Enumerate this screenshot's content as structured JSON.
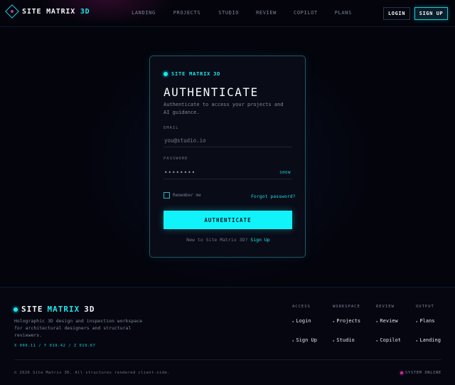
{
  "header": {
    "logo_main": "SITE MATRIX",
    "logo_accent": "3D",
    "nav": [
      "LANDING",
      "PROJECTS",
      "STUDIO",
      "REVIEW",
      "COPILOT",
      "PLANS"
    ],
    "login_label": "LOGIN",
    "signup_label": "SIGN UP"
  },
  "card": {
    "brand_main": "SITE MATRIX",
    "brand_accent": "3D",
    "title": "AUTHENTICATE",
    "subtitle": "Authenticate to access your projects and AI guidance.",
    "email_label": "EMAIL",
    "email_placeholder": "you@studio.io",
    "password_label": "PASSWORD",
    "password_value": "••••••••",
    "show_label": "SHOW",
    "remember_label": "Remember me",
    "forgot_label": "Forgot password?",
    "submit_label": "AUTHENTICATE",
    "new_prompt": "New to Site Matrix 3D?",
    "signup_link": "Sign Up"
  },
  "footer": {
    "brand_site": "SITE",
    "brand_matrix": "MATRIX",
    "brand_3d": "3D",
    "description": "Holographic 3D design and inspection workspace for architectural designers and structural reviewers.",
    "coords": "X 000.11 / Y 019.42 / Z 019.67",
    "columns": [
      {
        "heading": "ACCESS",
        "links": [
          "Login",
          "Sign Up"
        ]
      },
      {
        "heading": "WORKSPACE",
        "links": [
          "Projects",
          "Studio"
        ]
      },
      {
        "heading": "REVIEW",
        "links": [
          "Review",
          "Copilot"
        ]
      },
      {
        "heading": "OUTPUT",
        "links": [
          "Plans",
          "Landing"
        ]
      }
    ],
    "copyright": "© 2026 Site Matrix 3D. All structures rendered client-side.",
    "status": "SYSTEM ONLINE"
  },
  "colors": {
    "accent": "#19e8f0",
    "magenta": "#d02c9e",
    "background": "#03040c"
  },
  "icons": {
    "logo": "diamond-logo-icon",
    "status": "status-dot-icon"
  }
}
